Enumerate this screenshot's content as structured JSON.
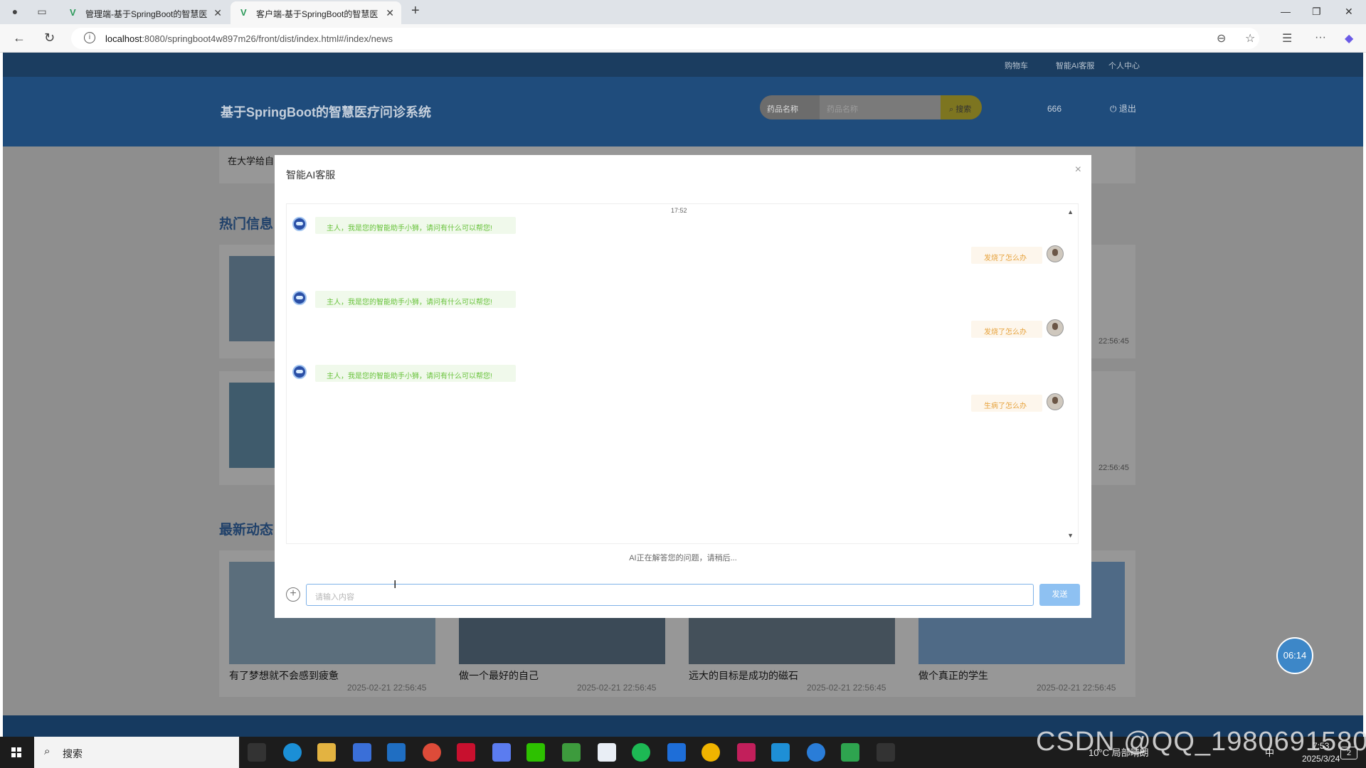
{
  "browser": {
    "tabs": [
      {
        "title": "管理端-基于SpringBoot的智慧医"
      },
      {
        "title": "客户端-基于SpringBoot的智慧医"
      }
    ],
    "url_host": "localhost",
    "url_rest": ":8080/springboot4w897m26/front/dist/index.html#/index/news"
  },
  "site": {
    "top_links": [
      "购物车",
      "智能AI客服",
      "个人中心"
    ],
    "logo": "基于SpringBoot的智慧医疗问诊系统",
    "search": {
      "select_label": "药品名称",
      "placeholder": "药品名称",
      "button": "搜索"
    },
    "username": "666",
    "logout": "退出",
    "partial_title": "在大学给自己定个目标",
    "sections": {
      "hot": "热门信息",
      "latest": "最新动态"
    },
    "hot_dates": [
      "22:56:45",
      "22:56:45"
    ],
    "news": [
      {
        "title": "有了梦想就不会感到疲惫",
        "date": "2025-02-21 22:56:45"
      },
      {
        "title": "做一个最好的自己",
        "date": "2025-02-21 22:56:45"
      },
      {
        "title": "远大的目标是成功的磁石",
        "date": "2025-02-21 22:56:45"
      },
      {
        "title": "做个真正的学生",
        "date": "2025-02-21 22:56:45"
      }
    ],
    "timer": "06:14"
  },
  "modal": {
    "title": "智能AI客服",
    "close": "×",
    "time": "17:52",
    "messages": [
      {
        "from": "bot",
        "text": "主人，我是您的智能助手小狮，请问有什么可以帮您!"
      },
      {
        "from": "user",
        "text": "发烧了怎么办"
      },
      {
        "from": "bot",
        "text": "主人，我是您的智能助手小狮，请问有什么可以帮您!"
      },
      {
        "from": "user",
        "text": "发烧了怎么办"
      },
      {
        "from": "bot",
        "text": "主人，我是您的智能助手小狮，请问有什么可以帮您!"
      },
      {
        "from": "user",
        "text": "生病了怎么办"
      }
    ],
    "status": "AI正在解答您的问题，请稍后...",
    "input_placeholder": "请输入内容",
    "send": "发送"
  },
  "taskbar": {
    "search": "搜索",
    "weather": "10°C 局部晴朗",
    "time": "7:53",
    "date": "2025/3/24",
    "ime": "中",
    "notifications": "2"
  },
  "watermark": "CSDN @QQ_1980691580",
  "colors": {
    "bot_bubble_bg": "#f0f9eb",
    "bot_text": "#67c23a",
    "user_bubble_bg": "#fdf6ec",
    "user_text": "#e6a23c",
    "send_button": "#8ec1f2",
    "header": "#1f4c7c"
  }
}
